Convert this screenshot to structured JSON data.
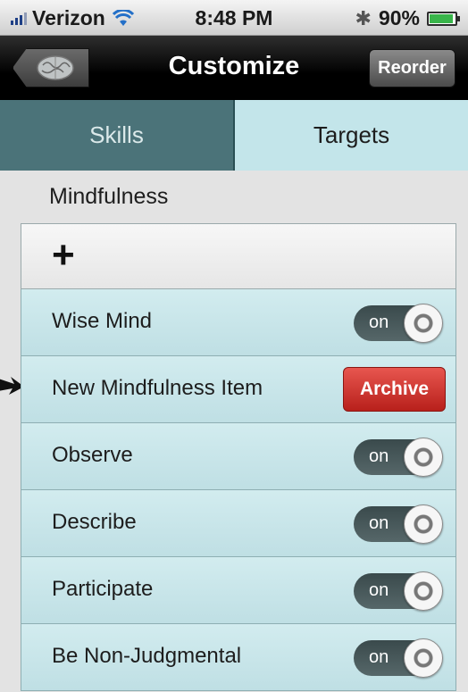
{
  "status_bar": {
    "carrier": "Verizon",
    "time": "8:48 PM",
    "battery_percent": "90%",
    "icons": [
      "signal-bars-icon",
      "wifi-icon",
      "bluetooth-icon",
      "battery-icon"
    ]
  },
  "navbar": {
    "title": "Customize",
    "back_icon": "brain-icon",
    "reorder_label": "Reorder"
  },
  "tabs": [
    {
      "label": "Skills",
      "active": true
    },
    {
      "label": "Targets",
      "active": false
    }
  ],
  "section": {
    "title": "Mindfulness",
    "add_icon": "plus-icon"
  },
  "items": [
    {
      "label": "Wise Mind",
      "toggle": "on"
    },
    {
      "label": "New Mindfulness Item",
      "action": "Archive"
    },
    {
      "label": "Observe",
      "toggle": "on"
    },
    {
      "label": "Describe",
      "toggle": "on"
    },
    {
      "label": "Participate",
      "toggle": "on"
    },
    {
      "label": "Be Non-Judgmental",
      "toggle": "on"
    }
  ],
  "colors": {
    "active_tab": "#4b7379",
    "inactive_tab": "#c3e5ea",
    "row": "#c8e6ea",
    "archive": "#d43a33"
  }
}
